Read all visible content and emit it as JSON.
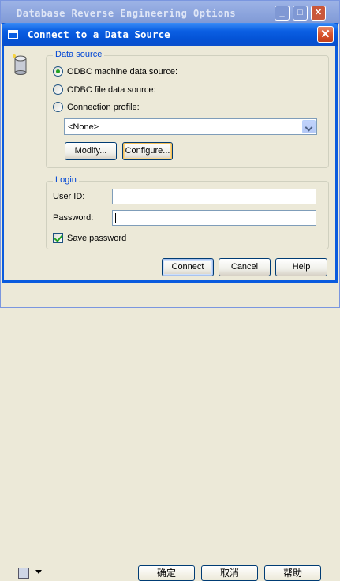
{
  "background_window": {
    "title": "Database Reverse Engineering Options",
    "controls": {
      "minimize": "_",
      "maximize": "□",
      "close": "✕"
    },
    "buttons": {
      "ok": "确定",
      "cancel": "取消",
      "help": "帮助"
    }
  },
  "dialog": {
    "title": "Connect to a Data Source",
    "close_glyph": "✕",
    "data_source": {
      "legend": "Data source",
      "options": [
        {
          "label": "ODBC machine data source:",
          "checked": true
        },
        {
          "label": "ODBC file data source:",
          "checked": false
        },
        {
          "label": "Connection profile:",
          "checked": false
        }
      ],
      "profile_select_value": "<None>",
      "modify_button": "Modify...",
      "configure_button": "Configure..."
    },
    "login": {
      "legend": "Login",
      "user_id_label": "User ID:",
      "user_id_value": "",
      "password_label": "Password:",
      "password_value": "",
      "save_password_label": "Save password",
      "save_password_checked": true
    },
    "buttons": {
      "connect": "Connect",
      "cancel": "Cancel",
      "help": "Help"
    }
  },
  "colors": {
    "title_bar": "#0a5bde",
    "legend_text": "#0046d5",
    "close_red": "#d8532b"
  },
  "icons": [
    "database-icon",
    "chevron-down-icon",
    "close-icon",
    "window-icon",
    "checkmark-icon"
  ]
}
